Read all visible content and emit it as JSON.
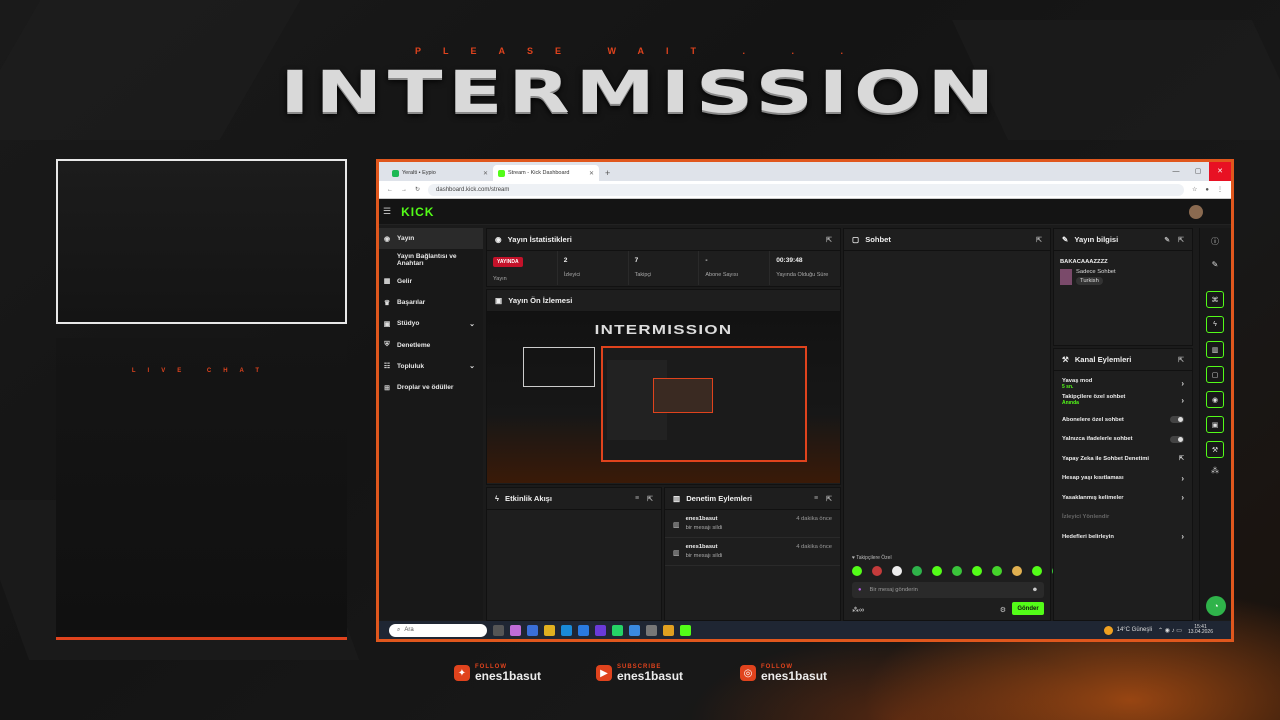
{
  "overlay": {
    "please_wait": "PLEASE WAIT . . .",
    "title": "INTERMISSION",
    "live_chat": "LIVE CHAT",
    "socials": [
      {
        "small": "FOLLOW",
        "name": "enes1basut",
        "icon": "twitter-icon"
      },
      {
        "small": "SUBSCRIBE",
        "name": "enes1basut",
        "icon": "youtube-icon"
      },
      {
        "small": "FOLLOW",
        "name": "enes1basut",
        "icon": "instagram-icon"
      }
    ],
    "accent": "#e0431d"
  },
  "browser": {
    "tabs": [
      {
        "label": "Yeralti • Eypio"
      },
      {
        "label": "Stream - Kick Dashboard"
      }
    ],
    "url": "dashboard.kick.com/stream"
  },
  "kick": {
    "logo": "KICK",
    "brand_color": "#53fc18",
    "sidebar": [
      {
        "label": "Yayın",
        "icon": "broadcast-icon"
      },
      {
        "label": "Yayın Bağlantısı ve Anahtarı",
        "icon": ""
      },
      {
        "label": "Gelir",
        "icon": "money-icon"
      },
      {
        "label": "Başarılar",
        "icon": "trophy-icon"
      },
      {
        "label": "Stüdyo",
        "icon": "studio-icon"
      },
      {
        "label": "Denetleme",
        "icon": "shield-icon"
      },
      {
        "label": "Topluluk",
        "icon": "community-icon"
      },
      {
        "label": "Droplar ve ödüller",
        "icon": "gift-icon"
      }
    ],
    "stats": {
      "title": "Yayın İstatistikleri",
      "status_badge": "YAYINDA",
      "status_label": "Yayın",
      "viewers_value": "2",
      "viewers_label": "İzleyici",
      "followers_value": "7",
      "followers_label": "Takipçi",
      "subs_value": "-",
      "subs_label": "Abone Sayısı",
      "uptime_value": "00:39:48",
      "uptime_label": "Yayında Olduğu Süre"
    },
    "preview": {
      "title": "Yayın Ön İzlemesi",
      "inner_title": "INTERMISSION"
    },
    "activity": {
      "title": "Etkinlik Akışı"
    },
    "mod_actions": {
      "title": "Denetim Eylemleri",
      "rows": [
        {
          "user": "enes1basut",
          "text": "bir mesajı sildi",
          "time": "4 dakika önce"
        },
        {
          "user": "enes1basut",
          "text": "bir mesajı sildi",
          "time": "4 dakika önce"
        }
      ]
    },
    "chat": {
      "title": "Sohbet",
      "followers_only": "Takipçilere Özel",
      "placeholder": "Bir mesaj gönderin",
      "send": "Gönder"
    },
    "stream_info": {
      "title": "Yayın bilgisi",
      "stream_title": "BAKACAAAZZZZ",
      "category": "Sadece Sohbet",
      "tag": "Turkish"
    },
    "channel_actions": {
      "title": "Kanal Eylemleri",
      "slow_mode": "Yavaş mod",
      "slow_mode_value": "5 sn.",
      "followers_chat": "Takipçilere özel sohbet",
      "followers_chat_value": "Anında",
      "subs_chat": "Abonelere özel sohbet",
      "emote_chat": "Yalnızca ifadelerle sohbet",
      "ai_moderation": "Yapay Zeka ile Sohbet Denetimi",
      "account_age": "Hesap yaşı kısıtlaması",
      "banned_words": "Yasaklanmış kelimeler",
      "viewer_redirect": "İzleyici Yönlendir",
      "goals": "Hedefleri belirleyin"
    }
  },
  "taskbar": {
    "search": "Ara",
    "weather": "14°C  Güneşli",
    "time": "15:41",
    "date": "13.04.2026"
  }
}
